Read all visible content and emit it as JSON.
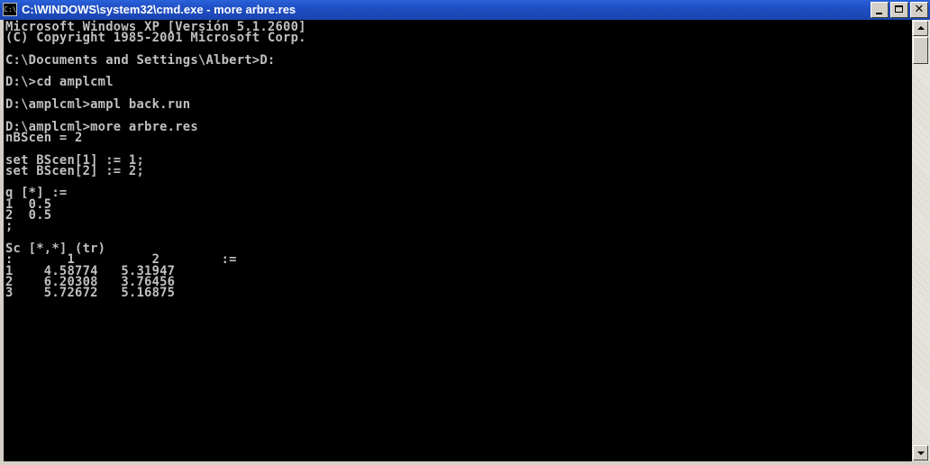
{
  "window": {
    "title": "C:\\WINDOWS\\system32\\cmd.exe - more arbre.res",
    "system_icon_text": "C:\\",
    "icons": {
      "system": "cmd-icon",
      "minimize": "minimize-icon",
      "maximize": "maximize-icon",
      "close": "close-icon"
    }
  },
  "console": {
    "colors": {
      "background": "#000000",
      "text": "#c0c0c0"
    },
    "lines": [
      "Microsoft Windows XP [Versión 5.1.2600]",
      "(C) Copyright 1985-2001 Microsoft Corp.",
      "",
      "C:\\Documents and Settings\\Albert>D:",
      "",
      "D:\\>cd amplcml",
      "",
      "D:\\amplcml>ampl back.run",
      "",
      "D:\\amplcml>more arbre.res",
      "nBScen = 2",
      "",
      "set BScen[1] := 1;",
      "set BScen[2] := 2;",
      "",
      "q [*] :=",
      "1  0.5",
      "2  0.5",
      ";",
      "",
      "Sc [*,*] (tr)",
      ":       1          2        :=",
      "1    4.58774   5.31947",
      "2    6.20308   3.76456",
      "3    5.72672   5.16875"
    ]
  },
  "scrollbar": {
    "up_icon": "arrow-up-icon",
    "down_icon": "arrow-down-icon"
  }
}
